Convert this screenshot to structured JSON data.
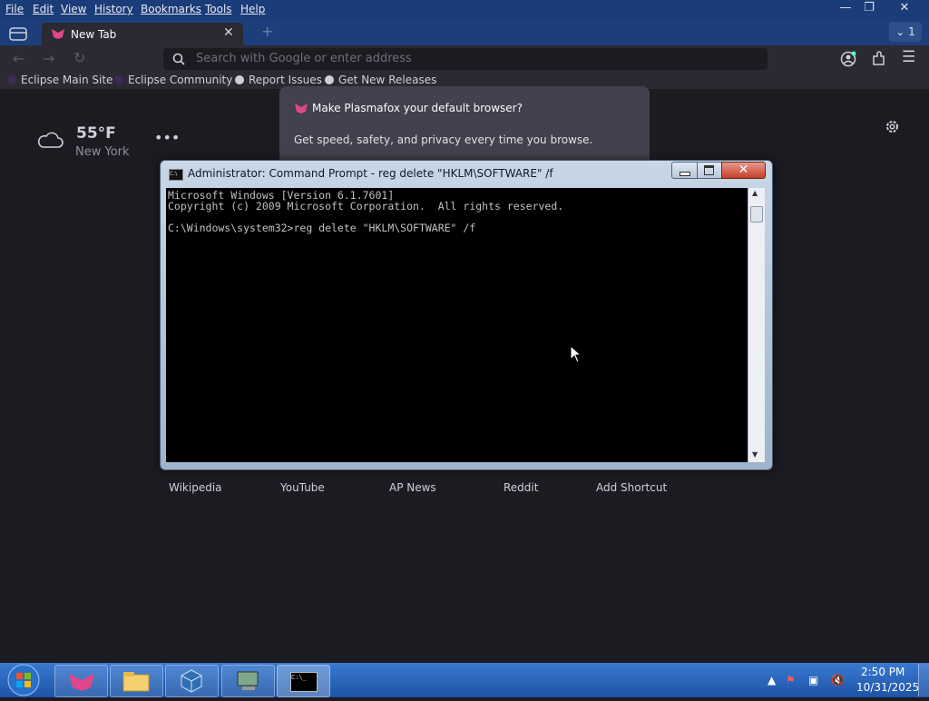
{
  "browser": {
    "menu": [
      "File",
      "Edit",
      "View",
      "History",
      "Bookmarks",
      "Tools",
      "Help"
    ],
    "tab_label": "New Tab",
    "tab_count": "1",
    "url_placeholder": "Search with Google or enter address",
    "bookmarks": [
      "Eclipse Main Site",
      "Eclipse Community",
      "Report Issues",
      "Get New Releases"
    ],
    "accent_color": "#e0468a"
  },
  "newtab": {
    "weather_temp": "55°F",
    "weather_city": "New York",
    "more_icon": "•••",
    "notification_title": "Make Plasmafox your default browser?",
    "notification_body": "Get speed, safety, and privacy every time you browse.",
    "shortcuts": [
      "Wikipedia",
      "YouTube",
      "AP News",
      "Reddit",
      "Add Shortcut"
    ]
  },
  "cmd": {
    "title": "Administrator: Command Prompt - reg  delete \"HKLM\\SOFTWARE\" /f",
    "lines": [
      "Microsoft Windows [Version 6.1.7601]",
      "Copyright (c) 2009 Microsoft Corporation.  All rights reserved.",
      "",
      "C:\\Windows\\system32>reg delete \"HKLM\\SOFTWARE\" /f"
    ],
    "close_glyph": "✕"
  },
  "taskbar": {
    "time": "2:50 PM",
    "date": "10/31/2025"
  }
}
